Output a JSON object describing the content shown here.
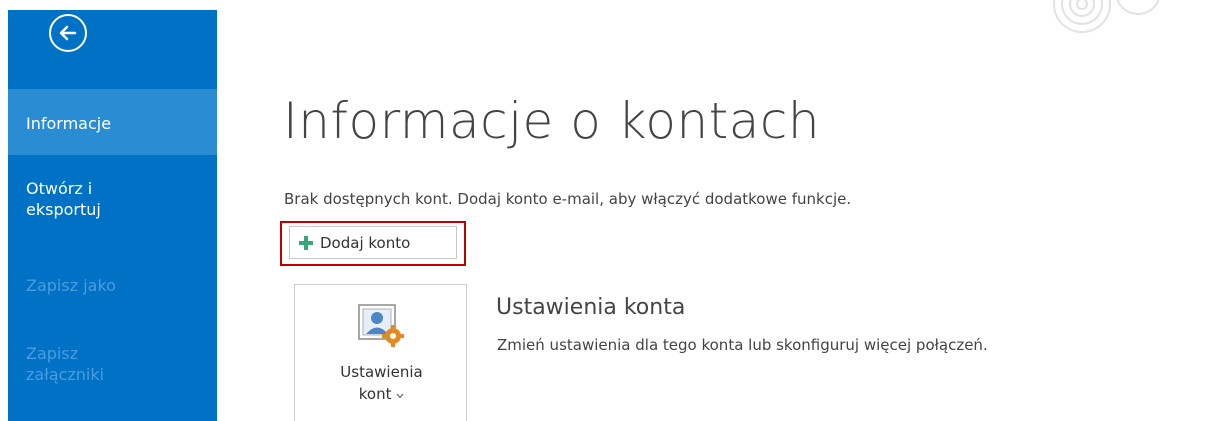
{
  "sidebar": {
    "items": [
      {
        "label": "Informacje",
        "state": "active"
      },
      {
        "label": "Otwórz i eksportuj",
        "line1": "Otwórz i",
        "line2": "eksportuj",
        "state": "enabled"
      },
      {
        "label": "Zapisz jako",
        "state": "disabled"
      },
      {
        "label": "Zapisz załączniki",
        "line1": "Zapisz",
        "line2": "załączniki",
        "state": "disabled"
      }
    ],
    "back_icon": "back-arrow-icon"
  },
  "main": {
    "title": "Informacje o kontach",
    "no_accounts_text": "Brak dostępnych kont. Dodaj konto e-mail, aby włączyć dodatkowe funkcje.",
    "add_account_button": "Dodaj konto",
    "account_settings": {
      "tile_label_line1": "Ustawienia",
      "tile_label_line2": "kont",
      "heading": "Ustawienia konta",
      "description": "Zmień ustawienia dla tego konta lub skonfiguruj więcej połączeń."
    }
  },
  "colors": {
    "sidebar_bg": "#0072c6",
    "sidebar_active": "#2a8dd4",
    "sidebar_disabled_text": "#4c9be0",
    "highlight": "#c00000",
    "plus_green": "#3aa57a",
    "text": "#444444"
  }
}
